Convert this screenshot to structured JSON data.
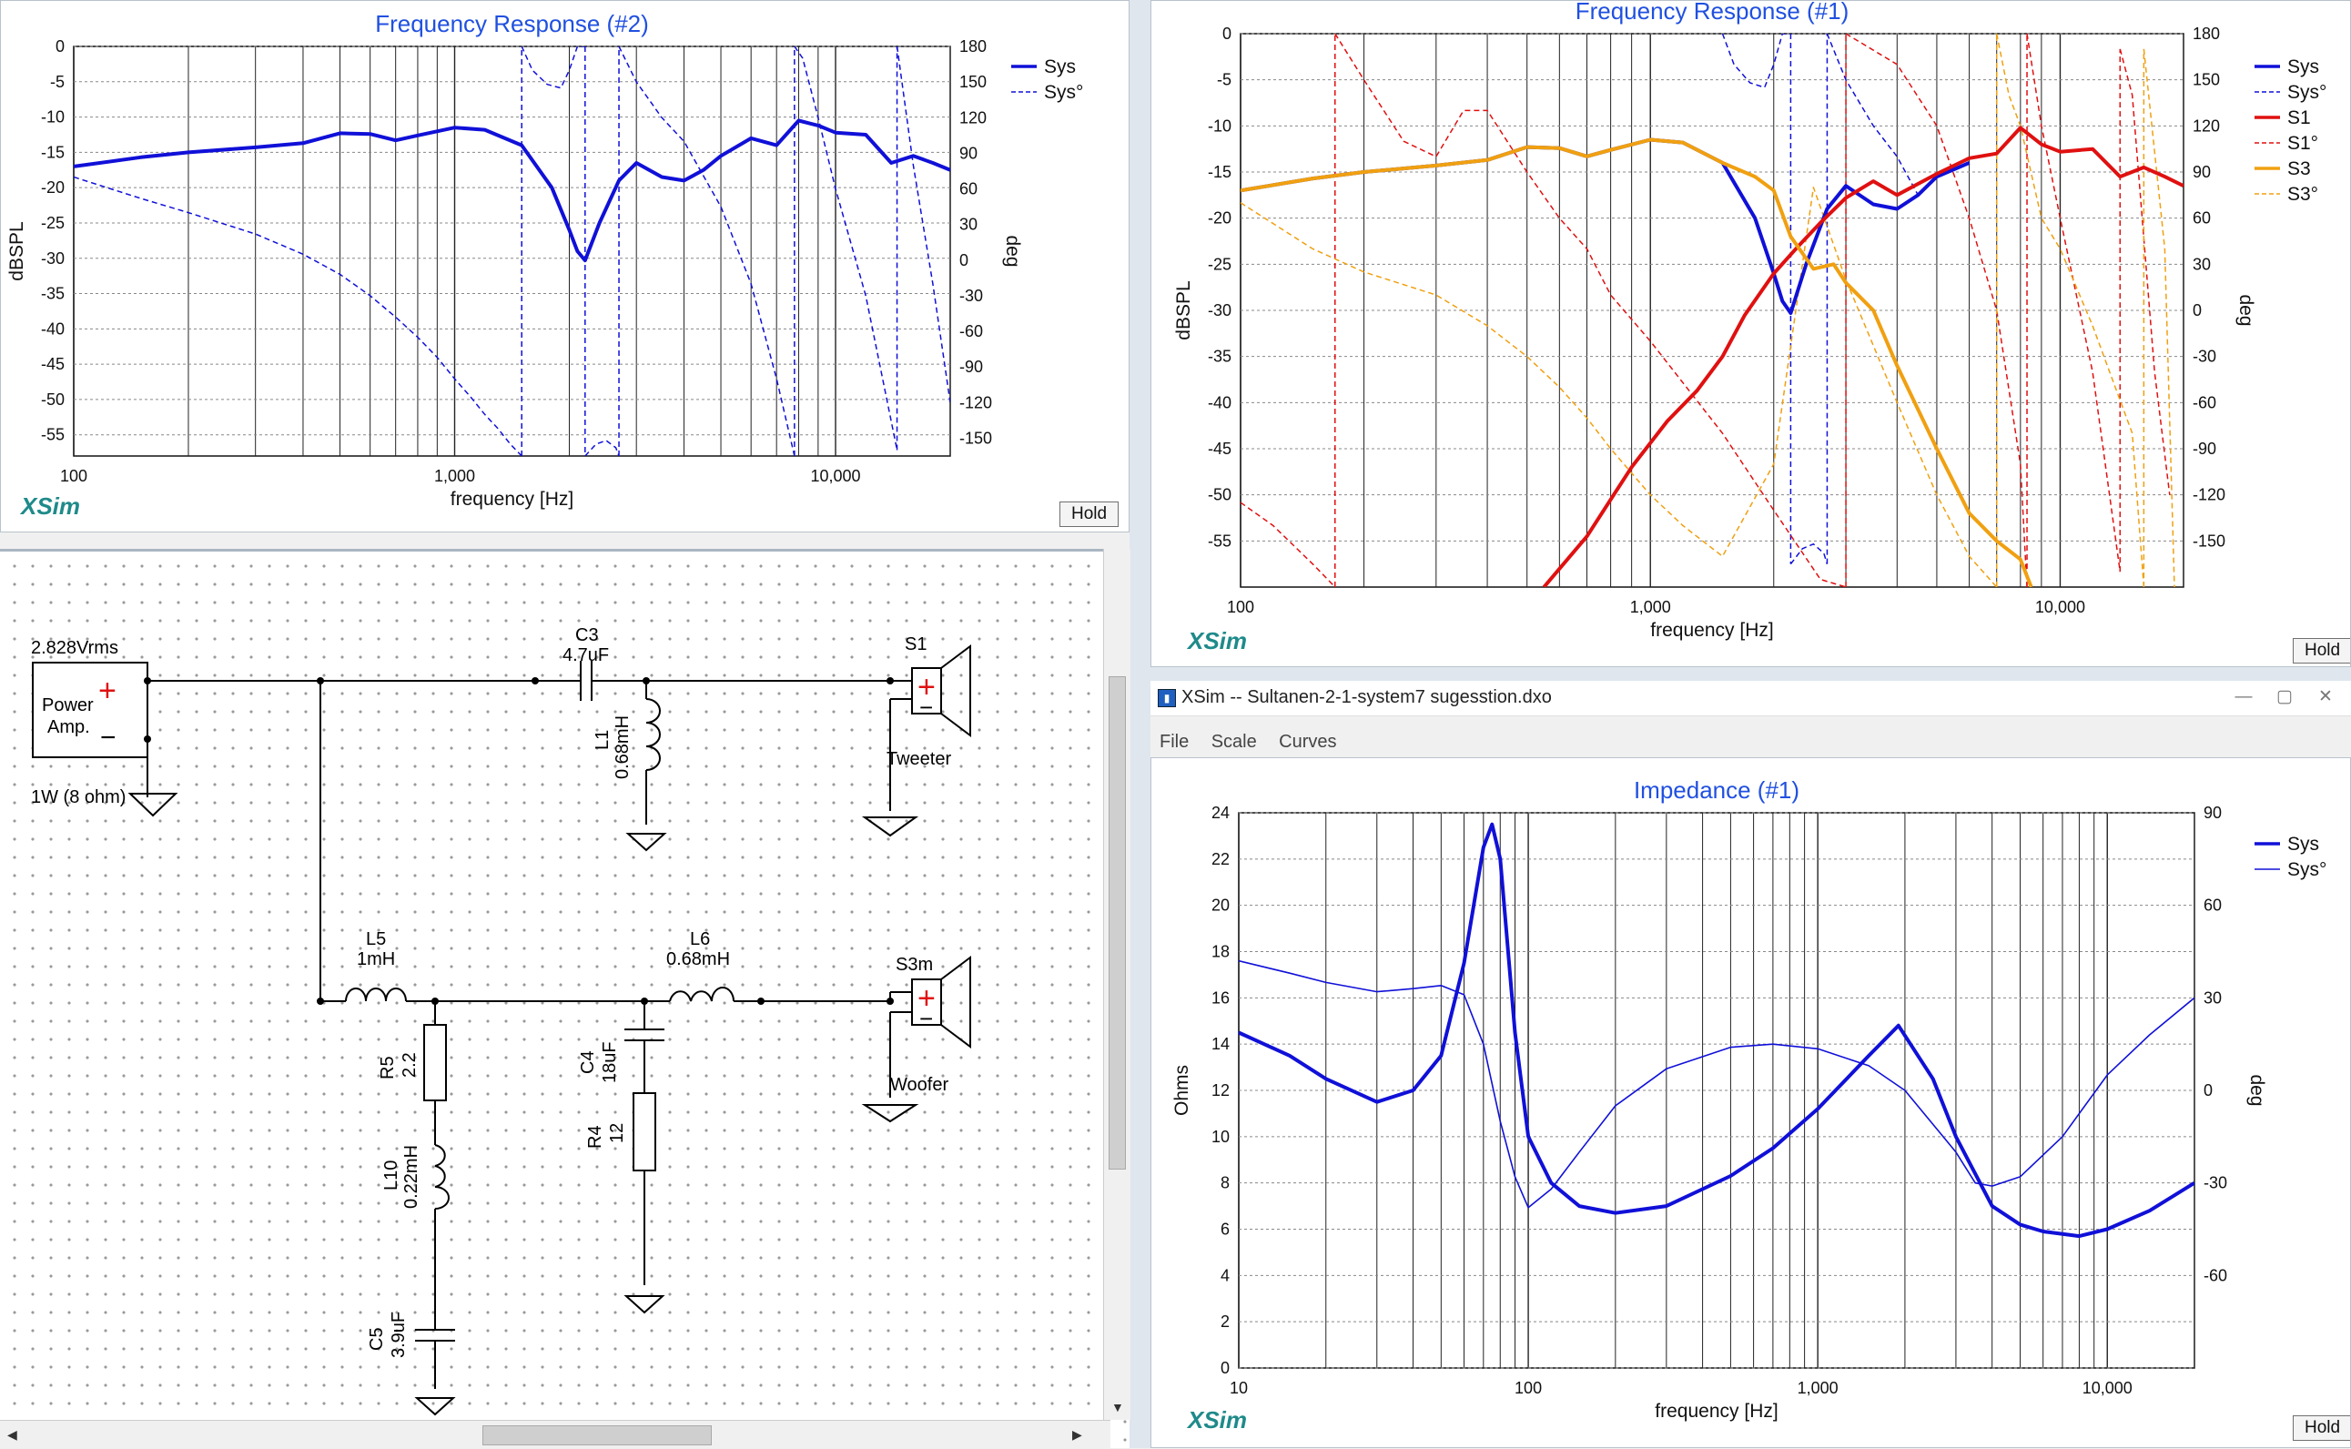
{
  "window": {
    "title": "XSim -- Sultanen-2-1-system7 sugesstion.dxo",
    "minimize": "—",
    "maximize": "▢",
    "close": "✕"
  },
  "menu": [
    "File",
    "Scale",
    "Curves"
  ],
  "brand": "XSim",
  "hold_label": "Hold",
  "colors": {
    "sys": "#1010d8",
    "s1": "#e01010",
    "s3": "#f0a010",
    "grid": "#111111"
  },
  "charts": {
    "fr2": {
      "title": "Frequency Response (#2)",
      "xlabel": "frequency [Hz]",
      "ylabel": "dBSPL",
      "y2label": "deg",
      "xticks": [
        "100",
        "1,000",
        "10,000"
      ],
      "yticks": [
        "0",
        "-5",
        "-10",
        "-15",
        "-20",
        "-25",
        "-30",
        "-35",
        "-40",
        "-45",
        "-50",
        "-55"
      ],
      "y2ticks": [
        "180",
        "150",
        "120",
        "90",
        "60",
        "30",
        "0",
        "-30",
        "-60",
        "-90",
        "-120",
        "-150"
      ],
      "legend": [
        "Sys",
        "Sys°"
      ]
    },
    "fr1": {
      "title": "Frequency Response (#1)",
      "xlabel": "frequency [Hz]",
      "ylabel": "dBSPL",
      "y2label": "deg",
      "xticks": [
        "100",
        "1,000",
        "10,000"
      ],
      "yticks": [
        "0",
        "-5",
        "-10",
        "-15",
        "-20",
        "-25",
        "-30",
        "-35",
        "-40",
        "-45",
        "-50",
        "-55"
      ],
      "y2ticks": [
        "180",
        "150",
        "120",
        "90",
        "60",
        "30",
        "0",
        "-30",
        "-60",
        "-90",
        "-120",
        "-150"
      ],
      "legend": [
        "Sys",
        "Sys°",
        "S1",
        "S1°",
        "S3",
        "S3°"
      ]
    },
    "imp": {
      "title": "Impedance (#1)",
      "xlabel": "frequency [Hz]",
      "ylabel": "Ohms",
      "y2label": "deg",
      "xticks": [
        "10",
        "100",
        "1,000",
        "10,000"
      ],
      "yticks": [
        "24",
        "22",
        "20",
        "18",
        "16",
        "14",
        "12",
        "10",
        "8",
        "6",
        "4",
        "2",
        "0"
      ],
      "y2ticks": [
        "90",
        "60",
        "30",
        "0",
        "-30",
        "-60"
      ],
      "legend": [
        "Sys",
        "Sys°"
      ]
    }
  },
  "chart_data": [
    {
      "type": "line",
      "title": "Frequency Response (#2)",
      "xlabel": "frequency [Hz]",
      "ylabel": "dBSPL",
      "y2label": "deg",
      "xscale": "log",
      "xlim": [
        100,
        20000
      ],
      "ylim": [
        -58,
        0
      ],
      "y2lim": [
        -165,
        180
      ],
      "grid": true,
      "legend": "top-right",
      "series": [
        {
          "name": "Sys",
          "axis": "left",
          "style": "solid-thick",
          "color": "#1010d8",
          "x": [
            100,
            150,
            200,
            300,
            400,
            500,
            600,
            700,
            800,
            1000,
            1200,
            1500,
            1800,
            2000,
            2100,
            2200,
            2400,
            2700,
            3000,
            3500,
            4000,
            4500,
            5000,
            6000,
            7000,
            8000,
            9000,
            10000,
            12000,
            14000,
            16000,
            18000,
            20000
          ],
          "y": [
            -17,
            -15.7,
            -15,
            -14.3,
            -13.7,
            -12.3,
            -12.4,
            -13.3,
            -12.6,
            -11.5,
            -11.8,
            -14,
            -20,
            -26,
            -29,
            -30.3,
            -25,
            -19,
            -16.5,
            -18.5,
            -19,
            -17.5,
            -15.5,
            -13,
            -14,
            -10.5,
            -11.2,
            -12.2,
            -12.5,
            -16.5,
            -15.5,
            -16.5,
            -17.5
          ]
        },
        {
          "name": "Sys°",
          "axis": "right",
          "style": "dashed-thin",
          "color": "#1010d8",
          "segments": [
            {
              "x": [
                100,
                150,
                200,
                300,
                400,
                500,
                600,
                700,
                800,
                900,
                1000,
                1100,
                1200,
                1300,
                1400,
                1500
              ],
              "y": [
                70,
                52,
                40,
                22,
                5,
                -12,
                -30,
                -48,
                -65,
                -82,
                -100,
                -115,
                -130,
                -142,
                -155,
                -165
              ]
            },
            {
              "x": [
                1500,
                1600,
                1750,
                1900,
                2000,
                2100,
                2200
              ],
              "y": [
                180,
                160,
                148,
                145,
                160,
                180,
                180
              ]
            },
            {
              "x": [
                2200,
                2350,
                2500,
                2650,
                2700
              ],
              "y": [
                -165,
                -155,
                -152,
                -158,
                -165
              ]
            },
            {
              "x": [
                2700,
                3000,
                3500,
                4000,
                5000,
                6000,
                7000,
                7800
              ],
              "y": [
                180,
                150,
                120,
                100,
                45,
                -20,
                -100,
                -165
              ]
            },
            {
              "x": [
                7800,
                8200,
                9000,
                10000,
                12000,
                14500
              ],
              "y": [
                180,
                170,
                120,
                60,
                -30,
                -160
              ]
            },
            {
              "x": [
                14500,
                16000,
                18000,
                20000
              ],
              "y": [
                180,
                80,
                -20,
                -120
              ]
            }
          ]
        }
      ]
    },
    {
      "type": "line",
      "title": "Frequency Response (#1)",
      "xlabel": "frequency [Hz]",
      "ylabel": "dBSPL",
      "y2label": "deg",
      "xscale": "log",
      "xlim": [
        100,
        20000
      ],
      "ylim": [
        -60,
        0
      ],
      "y2lim": [
        -180,
        180
      ],
      "grid": true,
      "legend": "top-right",
      "series": [
        {
          "name": "Sys",
          "axis": "left",
          "style": "solid-thick",
          "color": "#1010d8",
          "x": [
            100,
            150,
            200,
            300,
            400,
            500,
            600,
            700,
            800,
            1000,
            1200,
            1500,
            1800,
            2000,
            2100,
            2200,
            2400,
            2700,
            3000,
            3500,
            4000,
            4500,
            5000,
            6000
          ],
          "y": [
            -17,
            -15.7,
            -15,
            -14.3,
            -13.7,
            -12.3,
            -12.4,
            -13.3,
            -12.6,
            -11.5,
            -11.8,
            -14,
            -20,
            -26,
            -29,
            -30.3,
            -25,
            -19,
            -16.5,
            -18.5,
            -19,
            -17.5,
            -15.5,
            -14
          ]
        },
        {
          "name": "Sys°",
          "axis": "right",
          "style": "dashed-thin",
          "color": "#1010d8",
          "segments": [
            {
              "x": [
                1500,
                1600,
                1750,
                1900,
                2000,
                2100,
                2200
              ],
              "y": [
                180,
                160,
                148,
                145,
                160,
                180,
                180
              ]
            },
            {
              "x": [
                2200,
                2350,
                2500,
                2650,
                2700
              ],
              "y": [
                -165,
                -155,
                -152,
                -158,
                -165
              ]
            },
            {
              "x": [
                2700,
                3000,
                3500,
                4000,
                4500
              ],
              "y": [
                180,
                150,
                120,
                100,
                75
              ]
            }
          ]
        },
        {
          "name": "S1",
          "axis": "left",
          "style": "solid-thick",
          "color": "#e01010",
          "x": [
            550,
            700,
            900,
            1100,
            1300,
            1500,
            1700,
            2000,
            2300,
            2600,
            3000,
            3500,
            4000,
            5000,
            6000,
            7000,
            8000,
            9000,
            10000,
            12000,
            14000,
            16000,
            18000,
            20000
          ],
          "y": [
            -60,
            -54.5,
            -47,
            -42,
            -38.7,
            -35,
            -30.5,
            -26,
            -23,
            -20.5,
            -17.8,
            -16,
            -17.5,
            -15.2,
            -13.5,
            -13,
            -10.2,
            -12,
            -12.8,
            -12.5,
            -15.5,
            -14.5,
            -15.5,
            -16.5
          ]
        },
        {
          "name": "S1°",
          "axis": "right",
          "style": "dashed-thin",
          "color": "#e01010",
          "segments": [
            {
              "x": [
                100,
                120,
                150,
                170
              ],
              "y": [
                -125,
                -140,
                -165,
                -180
              ]
            },
            {
              "x": [
                170,
                200,
                250,
                300,
                350,
                400,
                500,
                600,
                700,
                800,
                1000,
                1500,
                2000,
                2600,
                3000
              ],
              "y": [
                180,
                150,
                110,
                100,
                130,
                130,
                90,
                60,
                40,
                10,
                -20,
                -80,
                -130,
                -175,
                -180
              ]
            },
            {
              "x": [
                3000,
                4000,
                5000,
                6000,
                7000,
                8000,
                8300
              ],
              "y": [
                180,
                160,
                120,
                60,
                0,
                -100,
                -180
              ]
            },
            {
              "x": [
                8300,
                9000,
                10000,
                12000,
                14000
              ],
              "y": [
                180,
                120,
                60,
                -40,
                -170
              ]
            },
            {
              "x": [
                14000,
                15000,
                17000,
                18500
              ],
              "y": [
                170,
                140,
                -40,
                -120
              ]
            }
          ]
        },
        {
          "name": "S3",
          "axis": "left",
          "style": "solid-thick",
          "color": "#f0a010",
          "x": [
            100,
            150,
            200,
            300,
            400,
            500,
            600,
            700,
            800,
            1000,
            1200,
            1500,
            1800,
            2000,
            2200,
            2500,
            2800,
            3000,
            3500,
            4000,
            5000,
            6000,
            7000,
            8000,
            8500
          ],
          "y": [
            -17,
            -15.7,
            -15,
            -14.3,
            -13.7,
            -12.3,
            -12.4,
            -13.3,
            -12.6,
            -11.5,
            -11.8,
            -14,
            -15.5,
            -17,
            -22,
            -25.5,
            -25,
            -27,
            -30,
            -36,
            -45,
            -52,
            -55,
            -57,
            -60
          ]
        },
        {
          "name": "S3°",
          "axis": "right",
          "style": "dashed-thin",
          "color": "#f0a010",
          "segments": [
            {
              "x": [
                100,
                150,
                200,
                300,
                400,
                500,
                600,
                700,
                800,
                1000,
                1200,
                1500,
                2000,
                2500,
                3000,
                4000,
                5000,
                6000,
                7000
              ],
              "y": [
                70,
                40,
                25,
                10,
                -10,
                -30,
                -50,
                -70,
                -90,
                -120,
                -140,
                -160,
                -100,
                80,
                20,
                -60,
                -120,
                -160,
                -180
              ]
            },
            {
              "x": [
                7000,
                7500,
                8000,
                9000,
                10000,
                12000,
                15000,
                16000
              ],
              "y": [
                180,
                140,
                120,
                60,
                40,
                -10,
                -80,
                -180
              ]
            },
            {
              "x": [
                16000,
                18000,
                19000
              ],
              "y": [
                170,
                40,
                -180
              ]
            }
          ]
        }
      ]
    },
    {
      "type": "line",
      "title": "Impedance (#1)",
      "xlabel": "frequency [Hz]",
      "ylabel": "Ohms",
      "y2label": "deg",
      "xscale": "log",
      "xlim": [
        10,
        20000
      ],
      "ylim": [
        0,
        24
      ],
      "y2lim": [
        -90,
        90
      ],
      "grid": true,
      "legend": "top-right",
      "series": [
        {
          "name": "Sys",
          "axis": "left",
          "style": "solid-thick",
          "color": "#1010d8",
          "x": [
            10,
            15,
            20,
            30,
            40,
            50,
            60,
            70,
            75,
            80,
            90,
            100,
            120,
            150,
            200,
            300,
            500,
            700,
            1000,
            1500,
            1900,
            2500,
            3000,
            4000,
            5000,
            6000,
            8000,
            10000,
            14000,
            20000
          ],
          "y": [
            14.5,
            13.5,
            12.5,
            11.5,
            12,
            13.5,
            17.5,
            22.5,
            23.5,
            22,
            14.5,
            10,
            8,
            7,
            6.7,
            7,
            8.3,
            9.5,
            11.2,
            13.5,
            14.8,
            12.5,
            10,
            7,
            6.2,
            5.9,
            5.7,
            6,
            6.8,
            8
          ]
        },
        {
          "name": "Sys°",
          "axis": "right",
          "style": "solid-thin",
          "color": "#1010d8",
          "x": [
            10,
            15,
            20,
            30,
            40,
            50,
            60,
            70,
            80,
            90,
            100,
            120,
            150,
            200,
            300,
            500,
            700,
            1000,
            1500,
            2000,
            3000,
            3500,
            4000,
            5000,
            7000,
            10000,
            14000,
            20000
          ],
          "y": [
            42,
            38,
            35,
            32,
            33,
            34,
            31,
            15,
            -10,
            -28,
            -38,
            -32,
            -20,
            -5,
            7,
            14,
            15,
            13.5,
            8,
            0,
            -20,
            -30,
            -31,
            -28,
            -15,
            5,
            18,
            30
          ]
        }
      ]
    }
  ],
  "schematic": {
    "source": {
      "voltage": "2.828Vrms",
      "name_line1": "Power",
      "name_line2": "Amp.",
      "power": "1W (8 ohm)"
    },
    "components": {
      "c3": {
        "ref": "C3",
        "value": "4.7uF"
      },
      "l1": {
        "ref": "L1",
        "value": "0.68mH"
      },
      "l5": {
        "ref": "L5",
        "value": "1mH"
      },
      "l6": {
        "ref": "L6",
        "value": "0.68mH"
      },
      "r5": {
        "ref": "R5",
        "value": "2.2"
      },
      "c4": {
        "ref": "C4",
        "value": "18uF"
      },
      "l10": {
        "ref": "L10",
        "value": "0.22mH"
      },
      "r4": {
        "ref": "R4",
        "value": "12"
      },
      "c5": {
        "ref": "C5",
        "value": "3.9uF"
      }
    },
    "drivers": {
      "s1": {
        "ref": "S1",
        "label": "Tweeter"
      },
      "s3m": {
        "ref": "S3m",
        "label": "Woofer"
      }
    },
    "plus": "+",
    "minus": "−"
  }
}
